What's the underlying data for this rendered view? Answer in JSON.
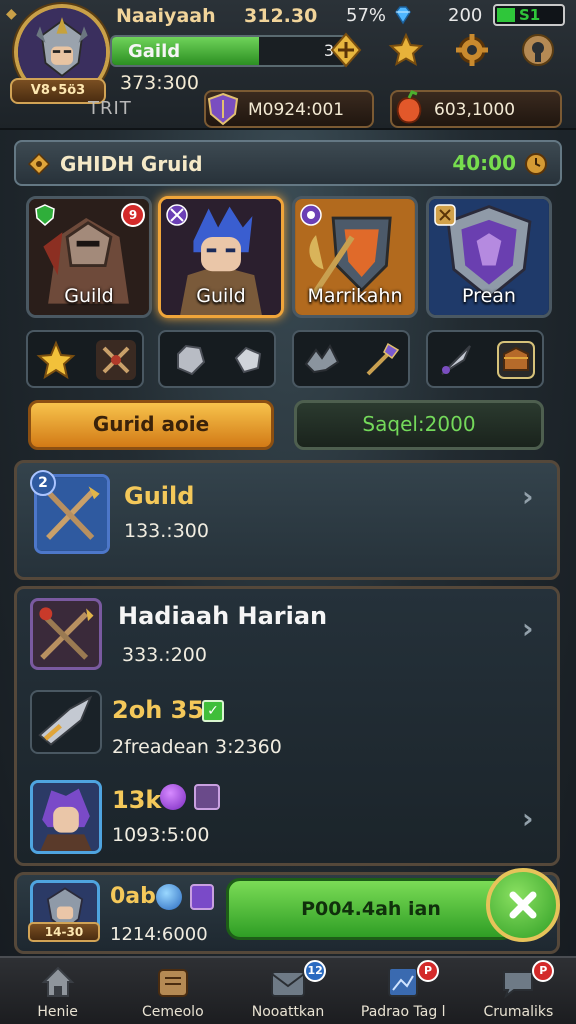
{
  "header": {
    "player_name": "Naaiyaah",
    "player_gold": "312.30",
    "level_plate": "V8•5ö3",
    "guild_bar_label": "Gaild",
    "guild_bar_count": "3",
    "guild_bar_progress_pct": 63,
    "gold_count": "373:300",
    "sub_tag": "TRIT",
    "resource_left": "M0924:001",
    "resource_right": "603,1000"
  },
  "status": {
    "percent": "57%",
    "gems": "200",
    "battery_text": "S1"
  },
  "guild_panel": {
    "title": "GHIDH Gruid",
    "timer": "40:00",
    "heroes": [
      {
        "label": "Guild",
        "badge": "9"
      },
      {
        "label": "Guild"
      },
      {
        "label": "Marrikahn"
      },
      {
        "label": "Prean"
      }
    ],
    "btn_left": "Gurid aoie",
    "btn_right": "Saqel:2000"
  },
  "guild_row": {
    "badge": "2",
    "title": "Guild",
    "sub": "133.:300"
  },
  "list": {
    "header_title": "Hadiaah Harian",
    "header_sub": "333.:200",
    "item2_title": "2oh 357",
    "item2_sub": "2freadean 3:2360",
    "item3_title": "13k",
    "item3_sub": "1093:5:00"
  },
  "bottom": {
    "title": "0ab",
    "level": "14-30",
    "sub": "1214:6000",
    "green_button": "P004.4ah ian"
  },
  "nav": [
    {
      "label": "Henie"
    },
    {
      "label": "Cemeolo"
    },
    {
      "label": "Nooattkan",
      "badge": "12"
    },
    {
      "label": "Padrao Tag l",
      "badge": "P"
    },
    {
      "label": "Crumaliks",
      "badge": "P"
    }
  ],
  "colors": {
    "accent_gold": "#f0a53a",
    "accent_green": "#2fc63a",
    "panel_border": "#55483a"
  }
}
